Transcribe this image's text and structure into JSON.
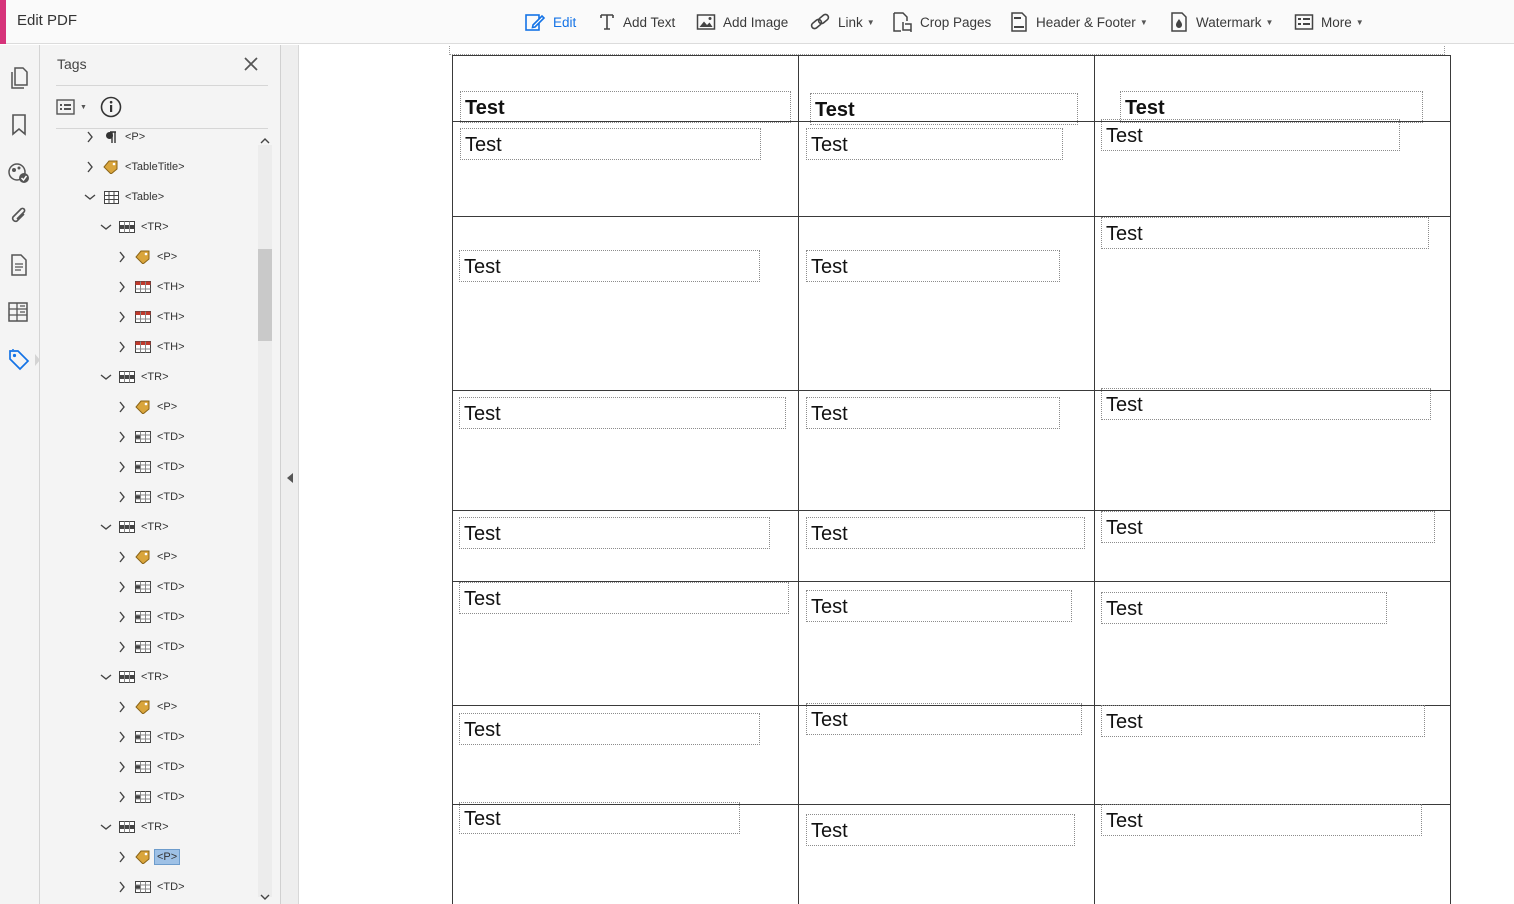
{
  "app": {
    "title": "Edit PDF"
  },
  "toolbar": {
    "items": [
      {
        "label": "Edit",
        "icon": "edit-icon",
        "has_menu": false,
        "active": true
      },
      {
        "label": "Add Text",
        "icon": "add-text-icon",
        "has_menu": false
      },
      {
        "label": "Add Image",
        "icon": "add-image-icon",
        "has_menu": false
      },
      {
        "label": "Link",
        "icon": "link-icon",
        "has_menu": true
      },
      {
        "label": "Crop Pages",
        "icon": "crop-pages-icon",
        "has_menu": false
      },
      {
        "label": "Header & Footer",
        "icon": "header-footer-icon",
        "has_menu": true
      },
      {
        "label": "Watermark",
        "icon": "watermark-icon",
        "has_menu": true
      },
      {
        "label": "More",
        "icon": "more-icon",
        "has_menu": true
      }
    ]
  },
  "rail": {
    "items": [
      {
        "icon": "pages-icon"
      },
      {
        "icon": "bookmark-icon"
      },
      {
        "icon": "content-icon"
      },
      {
        "icon": "attachments-icon"
      },
      {
        "icon": "document-icon"
      },
      {
        "icon": "order-icon"
      },
      {
        "icon": "tags-icon",
        "active": true
      }
    ]
  },
  "tags_panel": {
    "title": "Tags",
    "tree": [
      {
        "label": "<P>",
        "level": 0,
        "expanded": false,
        "icon": "paragraph-icon"
      },
      {
        "label": "<TableTitle>",
        "level": 0,
        "expanded": false,
        "icon": "tag-icon"
      },
      {
        "label": "<Table>",
        "level": 0,
        "expanded": true,
        "icon": "table-icon"
      },
      {
        "label": "<TR>",
        "level": 1,
        "expanded": true,
        "icon": "table-row-icon"
      },
      {
        "label": "<P>",
        "level": 2,
        "expanded": false,
        "icon": "tag-icon"
      },
      {
        "label": "<TH>",
        "level": 2,
        "expanded": false,
        "icon": "table-header-icon"
      },
      {
        "label": "<TH>",
        "level": 2,
        "expanded": false,
        "icon": "table-header-icon"
      },
      {
        "label": "<TH>",
        "level": 2,
        "expanded": false,
        "icon": "table-header-icon"
      },
      {
        "label": "<TR>",
        "level": 1,
        "expanded": true,
        "icon": "table-row-icon"
      },
      {
        "label": "<P>",
        "level": 2,
        "expanded": false,
        "icon": "tag-icon"
      },
      {
        "label": "<TD>",
        "level": 2,
        "expanded": false,
        "icon": "table-cell-icon"
      },
      {
        "label": "<TD>",
        "level": 2,
        "expanded": false,
        "icon": "table-cell-icon"
      },
      {
        "label": "<TD>",
        "level": 2,
        "expanded": false,
        "icon": "table-cell-icon"
      },
      {
        "label": "<TR>",
        "level": 1,
        "expanded": true,
        "icon": "table-row-icon"
      },
      {
        "label": "<P>",
        "level": 2,
        "expanded": false,
        "icon": "tag-icon"
      },
      {
        "label": "<TD>",
        "level": 2,
        "expanded": false,
        "icon": "table-cell-icon"
      },
      {
        "label": "<TD>",
        "level": 2,
        "expanded": false,
        "icon": "table-cell-icon"
      },
      {
        "label": "<TD>",
        "level": 2,
        "expanded": false,
        "icon": "table-cell-icon"
      },
      {
        "label": "<TR>",
        "level": 1,
        "expanded": true,
        "icon": "table-row-icon"
      },
      {
        "label": "<P>",
        "level": 2,
        "expanded": false,
        "icon": "tag-icon"
      },
      {
        "label": "<TD>",
        "level": 2,
        "expanded": false,
        "icon": "table-cell-icon"
      },
      {
        "label": "<TD>",
        "level": 2,
        "expanded": false,
        "icon": "table-cell-icon"
      },
      {
        "label": "<TD>",
        "level": 2,
        "expanded": false,
        "icon": "table-cell-icon"
      },
      {
        "label": "<TR>",
        "level": 1,
        "expanded": true,
        "icon": "table-row-icon"
      },
      {
        "label": "<P>",
        "level": 2,
        "expanded": false,
        "icon": "tag-icon",
        "selected": true
      },
      {
        "label": "<TD>",
        "level": 2,
        "expanded": false,
        "icon": "table-cell-icon"
      }
    ]
  },
  "document": {
    "table": {
      "rows": [
        {
          "cells": [
            "Test",
            "Test",
            "Test"
          ],
          "header": true
        },
        {
          "cells": [
            "Test",
            "Test",
            "Test"
          ]
        },
        {
          "cells": [
            "Test",
            "Test",
            "Test"
          ]
        },
        {
          "cells": [
            "Test",
            "Test",
            "Test"
          ]
        },
        {
          "cells": [
            "Test",
            "Test",
            "Test"
          ]
        },
        {
          "cells": [
            "Test",
            "Test",
            "Test"
          ]
        },
        {
          "cells": [
            "Test",
            "Test",
            "Test"
          ]
        },
        {
          "cells": [
            "Test",
            "Test",
            "Test"
          ]
        }
      ]
    }
  }
}
